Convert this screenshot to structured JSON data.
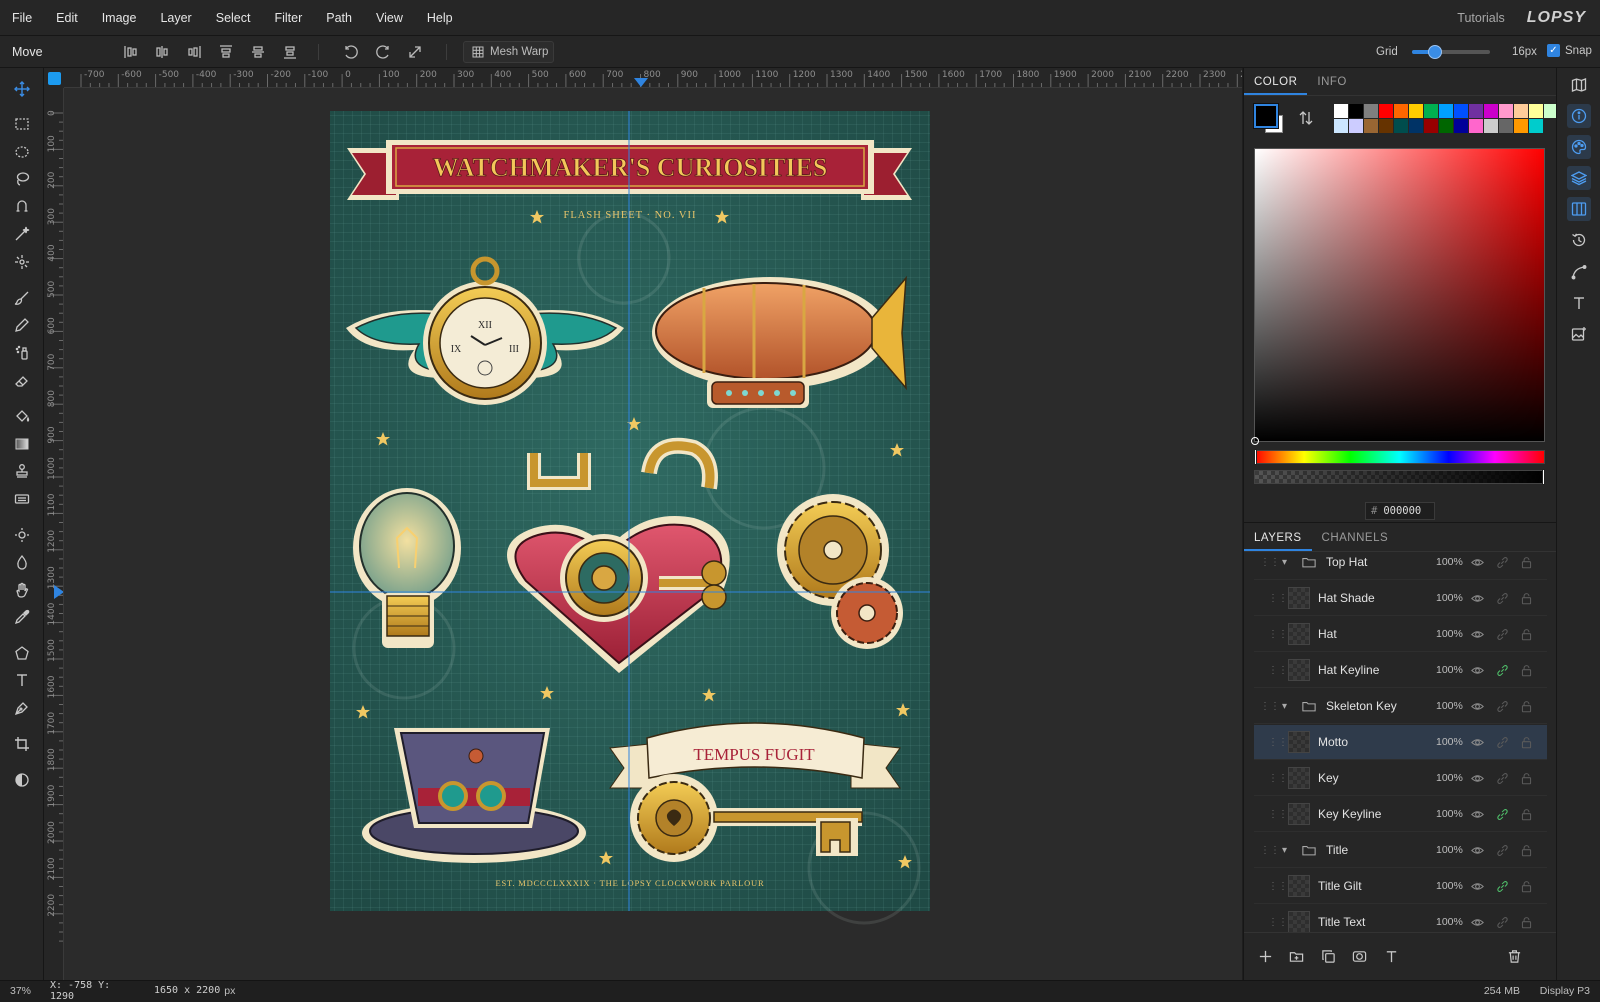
{
  "menu": {
    "items": [
      "File",
      "Edit",
      "Image",
      "Layer",
      "Select",
      "Filter",
      "Path",
      "View",
      "Help"
    ],
    "tutorials": "Tutorials",
    "logo": "LOPSY"
  },
  "options": {
    "tool_name": "Move",
    "mesh_warp": "Mesh Warp",
    "grid_label": "Grid",
    "grid_value": "16px",
    "snap_label": "Snap",
    "snap_checked": true,
    "grid_slider_fraction": 0.3
  },
  "ruler": {
    "top_labels": [
      "-700",
      "-600",
      "-500",
      "-400",
      "-300",
      "-200",
      "-100",
      "0",
      "100",
      "200",
      "300",
      "400",
      "500",
      "600",
      "700",
      "800",
      "900",
      "1000",
      "1100",
      "1200",
      "1300",
      "1400",
      "1500",
      "1600",
      "1700",
      "1800",
      "1900",
      "2000",
      "2100",
      "2200",
      "2300",
      "24"
    ],
    "left_labels": [
      "0",
      "100",
      "200",
      "300",
      "400",
      "500",
      "600",
      "700",
      "800",
      "900",
      "1000",
      "1100",
      "1200",
      "1300",
      "1400",
      "1500",
      "1600",
      "1700",
      "1800",
      "1900",
      "2000",
      "2100",
      "2200"
    ]
  },
  "artwork": {
    "title": "WATCHMAKER'S CURIOSITIES",
    "subtitle": "FLASH SHEET · NO. VII",
    "motto": "TEMPUS FUGIT",
    "footer": "EST. MDCCCLXXXIX  ·  THE LOPSY CLOCKWORK PARLOUR",
    "clock_numerals": [
      "XII",
      "III",
      "IX"
    ]
  },
  "color_panel": {
    "tabs": [
      "COLOR",
      "INFO"
    ],
    "hex_prefix": "#",
    "hex": "000000",
    "foreground": "#000000",
    "swatches": [
      "#ffffff",
      "#000000",
      "#7f7f7f",
      "#ff0000",
      "#ff6600",
      "#ffcc00",
      "#00b050",
      "#00a0ff",
      "#0050ff",
      "#7030a0",
      "#cc00cc",
      "#ff99cc",
      "#ffcc99",
      "#ffff99",
      "#ccffcc",
      "#cce6ff",
      "#ccccff",
      "#996633",
      "#663300",
      "#004d4d",
      "#003366",
      "#990000",
      "#006600",
      "#000099",
      "#ff66cc",
      "#cccccc",
      "#666666",
      "#ff9900",
      "#00cccc"
    ]
  },
  "layers_panel": {
    "tabs": [
      "LAYERS",
      "CHANNELS"
    ],
    "layers": [
      {
        "name": "Top Hat",
        "opacity": "100%",
        "group": true,
        "linked": false
      },
      {
        "name": "Hat Shade",
        "opacity": "100%",
        "group": false,
        "linked": false
      },
      {
        "name": "Hat",
        "opacity": "100%",
        "group": false,
        "linked": false
      },
      {
        "name": "Hat Keyline",
        "opacity": "100%",
        "group": false,
        "linked": true
      },
      {
        "name": "Skeleton Key",
        "opacity": "100%",
        "group": true,
        "linked": false
      },
      {
        "name": "Motto",
        "opacity": "100%",
        "group": false,
        "linked": false,
        "selected": true
      },
      {
        "name": "Key",
        "opacity": "100%",
        "group": false,
        "linked": false
      },
      {
        "name": "Key Keyline",
        "opacity": "100%",
        "group": false,
        "linked": true
      },
      {
        "name": "Title",
        "opacity": "100%",
        "group": true,
        "linked": false
      },
      {
        "name": "Title Gilt",
        "opacity": "100%",
        "group": false,
        "linked": true
      },
      {
        "name": "Title Text",
        "opacity": "100%",
        "group": false,
        "linked": false
      }
    ]
  },
  "status": {
    "zoom": "37%",
    "cursor": "X: -758  Y: 1290",
    "doc_size": "1650 x 2200",
    "doc_unit": "px",
    "memory": "254 MB",
    "profile": "Display P3"
  }
}
